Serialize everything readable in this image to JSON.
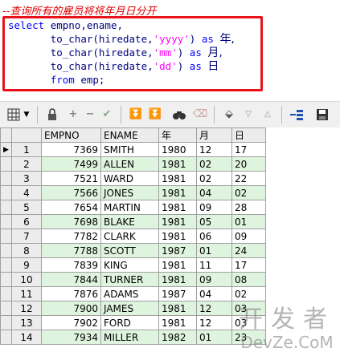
{
  "editor": {
    "comment": "--查询所有的雇员将将年月日分开",
    "line1": {
      "kw": "select",
      "rest": "empno,ename,"
    },
    "line2": {
      "fn": "to_char(hiredate,",
      "str": "'yyyy'",
      "close": ")",
      "as": "as",
      "alias": "年,"
    },
    "line3": {
      "fn": "to_char(hiredate,",
      "str": "'mm'",
      "close": ")",
      "as": "as",
      "alias": "月,"
    },
    "line4": {
      "fn": "to_char(hiredate,",
      "str": "'dd'",
      "close": ")",
      "as": "as",
      "alias": "日"
    },
    "line5": {
      "kw": "from",
      "rest": "emp;"
    }
  },
  "toolbar": {
    "icons": [
      "grid-layout-icon",
      "dropdown-arrow-icon",
      "lock-icon",
      "add-row-icon",
      "delete-row-icon",
      "post-check-icon",
      "first-record-icon",
      "last-record-icon",
      "find-icon",
      "clear-icon",
      "query-icon",
      "next-icon",
      "prev-icon",
      "export-icon",
      "save-icon"
    ]
  },
  "grid": {
    "columns": [
      "EMPNO",
      "ENAME",
      "年",
      "月",
      "日"
    ],
    "rows": [
      {
        "n": "1",
        "empno": "7369",
        "ename": "SMITH",
        "y": "1980",
        "m": "12",
        "d": "17"
      },
      {
        "n": "2",
        "empno": "7499",
        "ename": "ALLEN",
        "y": "1981",
        "m": "02",
        "d": "20"
      },
      {
        "n": "3",
        "empno": "7521",
        "ename": "WARD",
        "y": "1981",
        "m": "02",
        "d": "22"
      },
      {
        "n": "4",
        "empno": "7566",
        "ename": "JONES",
        "y": "1981",
        "m": "04",
        "d": "02"
      },
      {
        "n": "5",
        "empno": "7654",
        "ename": "MARTIN",
        "y": "1981",
        "m": "09",
        "d": "28"
      },
      {
        "n": "6",
        "empno": "7698",
        "ename": "BLAKE",
        "y": "1981",
        "m": "05",
        "d": "01"
      },
      {
        "n": "7",
        "empno": "7782",
        "ename": "CLARK",
        "y": "1981",
        "m": "06",
        "d": "09"
      },
      {
        "n": "8",
        "empno": "7788",
        "ename": "SCOTT",
        "y": "1987",
        "m": "01",
        "d": "24"
      },
      {
        "n": "9",
        "empno": "7839",
        "ename": "KING",
        "y": "1981",
        "m": "11",
        "d": "17"
      },
      {
        "n": "10",
        "empno": "7844",
        "ename": "TURNER",
        "y": "1981",
        "m": "09",
        "d": "08"
      },
      {
        "n": "11",
        "empno": "7876",
        "ename": "ADAMS",
        "y": "1987",
        "m": "04",
        "d": "02"
      },
      {
        "n": "12",
        "empno": "7900",
        "ename": "JAMES",
        "y": "1981",
        "m": "12",
        "d": "03"
      },
      {
        "n": "13",
        "empno": "7902",
        "ename": "FORD",
        "y": "1981",
        "m": "12",
        "d": "03"
      },
      {
        "n": "14",
        "empno": "7934",
        "ename": "MILLER",
        "y": "1982",
        "m": "01",
        "d": "23"
      }
    ],
    "current_row_marker": "▶",
    "alt_row_color": "#dff4df"
  },
  "watermark": {
    "line1": "开发者",
    "line2": "DevZe.CoM"
  }
}
